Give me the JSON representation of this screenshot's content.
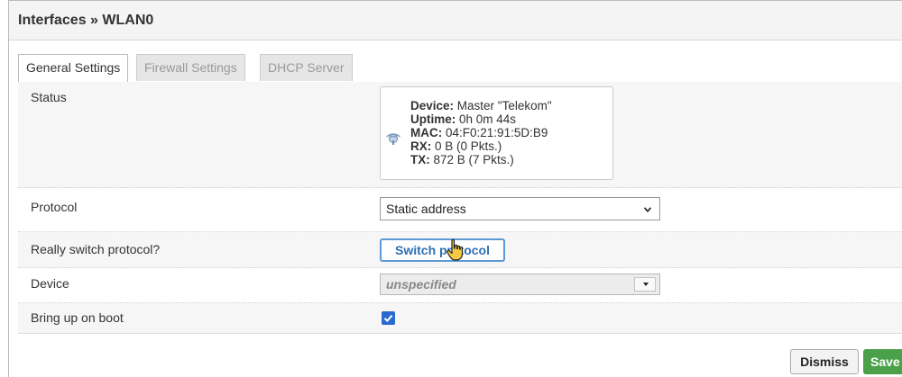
{
  "modal": {
    "title": "Interfaces » WLAN0"
  },
  "tabs": [
    {
      "label": "General Settings",
      "active": true
    },
    {
      "label": "Firewall Settings",
      "active": false
    },
    {
      "label": "DHCP Server",
      "active": false
    }
  ],
  "status": {
    "label": "Status",
    "icon": "wifi-signal-icon",
    "device_key": "Device:",
    "device_val": "Master \"Telekom\"",
    "uptime_key": "Uptime:",
    "uptime_val": "0h 0m 44s",
    "mac_key": "MAC:",
    "mac_val": "04:F0:21:91:5D:B9",
    "rx_key": "RX:",
    "rx_val": "0 B (0 Pkts.)",
    "tx_key": "TX:",
    "tx_val": "872 B (7 Pkts.)"
  },
  "protocol": {
    "label": "Protocol",
    "value": "Static address"
  },
  "switch": {
    "label": "Really switch protocol?",
    "button": "Switch protocol"
  },
  "device": {
    "label": "Device",
    "value": "unspecified"
  },
  "boot": {
    "label": "Bring up on boot",
    "checked": true
  },
  "footer": {
    "dismiss": "Dismiss",
    "save": "Save"
  },
  "colors": {
    "save": "#4aa14a",
    "switch_border": "#5d9ad4",
    "checkbox": "#2a6ad0"
  }
}
